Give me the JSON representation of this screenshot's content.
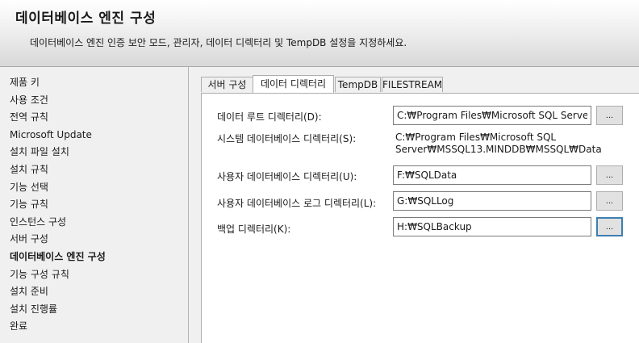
{
  "header": {
    "title": "데이터베이스 엔진 구성",
    "subtitle": "데이터베이스 엔진 인증 보안 모드, 관리자, 데이터 디렉터리 및 TempDB 설정을 지정하세요."
  },
  "sidebar": {
    "items": [
      {
        "label": "제품 키"
      },
      {
        "label": "사용 조건"
      },
      {
        "label": "전역 규칙"
      },
      {
        "label": "Microsoft Update"
      },
      {
        "label": "설치 파일 설치"
      },
      {
        "label": "설치 규칙"
      },
      {
        "label": "기능 선택"
      },
      {
        "label": "기능 규칙"
      },
      {
        "label": "인스턴스 구성"
      },
      {
        "label": "서버 구성"
      },
      {
        "label": "데이터베이스 엔진 구성",
        "active": true
      },
      {
        "label": "기능 구성 규칙"
      },
      {
        "label": "설치 준비"
      },
      {
        "label": "설치 진행률"
      },
      {
        "label": "완료"
      }
    ]
  },
  "tabs": [
    {
      "label": "서버 구성"
    },
    {
      "label": "데이터 디렉터리",
      "active": true
    },
    {
      "label": "TempDB"
    },
    {
      "label": "FILESTREAM"
    }
  ],
  "form": {
    "data_root": {
      "label": "데이터 루트 디렉터리(D):",
      "value": "C:₩Program Files₩Microsoft SQL Server₩",
      "button": "..."
    },
    "system_db": {
      "label": "시스템 데이터베이스 디렉터리(S):",
      "value_line1": "C:₩Program Files₩Microsoft SQL",
      "value_line2": "Server₩MSSQL13.MINDDB₩MSSQL₩Data"
    },
    "user_db": {
      "label": "사용자 데이터베이스 디렉터리(U):",
      "value": "F:₩SQLData",
      "button": "..."
    },
    "user_log": {
      "label": "사용자 데이터베이스 로그 디렉터리(L):",
      "value": "G:₩SQLLog",
      "button": "..."
    },
    "backup": {
      "label": "백업 디렉터리(K):",
      "value": "H:₩SQLBackup",
      "button": "..."
    }
  }
}
